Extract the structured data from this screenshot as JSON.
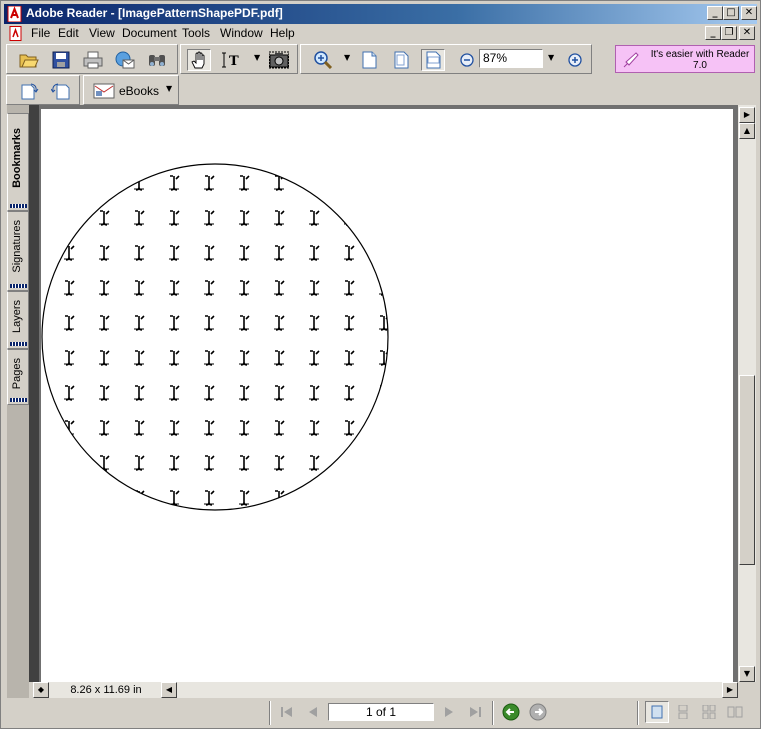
{
  "window": {
    "title": "Adobe Reader - [ImagePatternShapePDF.pdf]",
    "minimize": "_",
    "maximize": "□",
    "close": "✕"
  },
  "menubar": {
    "items": [
      "File",
      "Edit",
      "View",
      "Document",
      "Tools",
      "Window",
      "Help"
    ],
    "doc_minimize": "_",
    "doc_restore": "❐",
    "doc_close": "✕"
  },
  "toolbar": {
    "zoom_value": "87%",
    "promo_text": "It's easier with Reader 7.0",
    "ebooks_label": "eBooks"
  },
  "sidebar": {
    "tabs": [
      "Bookmarks",
      "Signatures",
      "Layers",
      "Pages"
    ]
  },
  "document": {
    "page_size": "8.26 x 11.69 in",
    "pattern_glyph": "ᔕ"
  },
  "statusbar": {
    "page_indicator": "1 of 1"
  },
  "colors": {
    "titlebar_start": "#0a246a",
    "promo_bg": "#f6c2f6",
    "nav_green": "#3a8a2a"
  },
  "icons": [
    "open-icon",
    "save-icon",
    "print-icon",
    "email-icon",
    "search-icon",
    "hand-tool-icon",
    "select-text-icon",
    "snapshot-icon",
    "zoom-in-tool-icon",
    "actual-size-icon",
    "fit-page-icon",
    "fit-width-icon",
    "zoom-out-icon",
    "zoom-in-icon"
  ]
}
